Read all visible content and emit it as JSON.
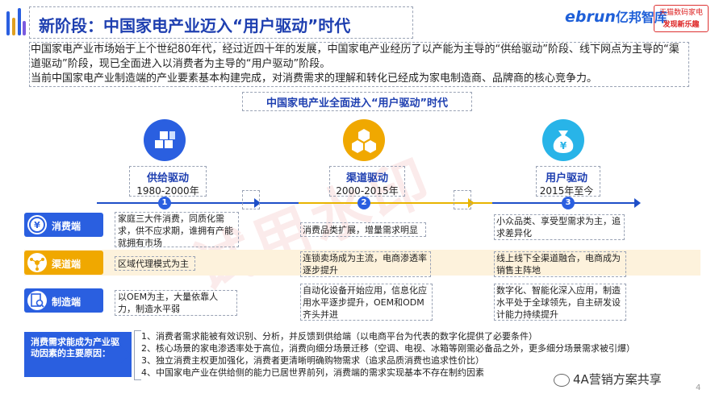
{
  "header": {
    "title": "新阶段：中国家电产业迈入“用户驱动”时代",
    "logo_main": "ebrun",
    "logo_cn": "亿邦智库",
    "logo2_line1": "天猫数码家电",
    "logo2_line2": "发现新乐趣"
  },
  "intro": {
    "line1": "中国家电产业市场始于上个世纪80年代，经过近四十年的发展，中国家电产业经历了以产能为主导的“供给驱动”阶段、线下网点为主导的“渠道驱动”阶段，现已全面进入以消费者为主导的“用户驱动”阶段。",
    "line2": "当前中国家电产业制造端的产业要素基本构建完成，对消费需求的理解和转化已经成为家电制造商、品牌商的核心竞争力。"
  },
  "subtitle": "中国家电产业全面进入“用户驱动”时代",
  "stages": [
    {
      "name": "供给驱动",
      "years": "1980-2000年",
      "num": "1",
      "icon": "cubes-icon",
      "color": "#2a5fe0"
    },
    {
      "name": "渠道驱动",
      "years": "2000-2015年",
      "num": "2",
      "icon": "hexagons-icon",
      "color": "#f0a800"
    },
    {
      "name": "用户驱动",
      "years": "2015年至今",
      "num": "3",
      "icon": "money-bag-icon",
      "color": "#28b4e8"
    }
  ],
  "rows": [
    {
      "label": "消费端",
      "icon": "yen-icon",
      "cells": [
        "家庭三大件消费，同质化需求，供不应求期，谁拥有产能就拥有市场",
        "消费品类扩展，增量需求明显",
        "小众品类、享受型需求为主，追求差异化"
      ]
    },
    {
      "label": "渠道端",
      "icon": "network-icon",
      "cells": [
        "区域代理模式为主",
        "连锁卖场成为主流，电商渗透率逐步提升",
        "线上线下全渠道融合，电商成为销售主阵地"
      ]
    },
    {
      "label": "制造端",
      "icon": "document-search-icon",
      "cells": [
        "以OEM为主，大量依靠人力，制造水平弱",
        "自动化设备开始应用，信息化应用水平逐步提升，OEM和ODM齐头并进",
        "数字化、智能化深入应用，制造水平处于全球领先，自主研发设计能力持续提升"
      ]
    }
  ],
  "reasons": {
    "title": "消费需求能成为产业驱动因素的主要原因：",
    "items": [
      "1、消费者需求能被有效识别、分析，并反馈到供给端（以电商平台为代表的数字化提供了必要条件）",
      "2、核心场景的家电渗透率处于高位，消费向细分场景迁移（空调、电视、冰箱等刚需必备品之外，更多细分场景需求被引爆）",
      "3、独立消费主权更加强化，消费者更清晰明确购物需求（追求品质消费也追求性价比）",
      "4、中国家电产业在供给侧的能力已居世界前列，消费端的需求实现基本不存在制约因素"
    ]
  },
  "watermark": "试用水印",
  "footer": "4A营销方案共享",
  "page_number": "4",
  "colors": {
    "primary": "#1e3fb0",
    "accent_blue": "#2a5fe0",
    "accent_gold": "#f0a800",
    "accent_cyan": "#28b4e8",
    "band": "#fdf2dc"
  }
}
